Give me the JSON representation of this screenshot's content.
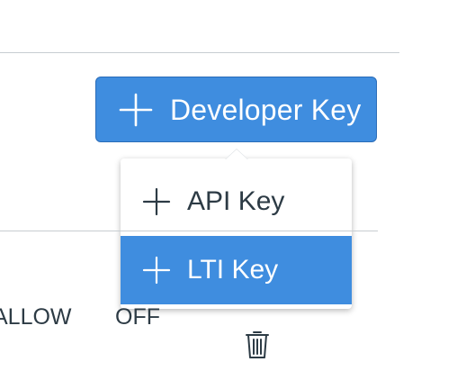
{
  "toolbar": {
    "developer_key_label": "Developer Key"
  },
  "menu": {
    "items": [
      {
        "label": "API Key",
        "selected": false
      },
      {
        "label": "LTI Key",
        "selected": true
      }
    ]
  },
  "table": {
    "row": {
      "status": "ALLOW",
      "state": "OFF"
    }
  },
  "colors": {
    "accent": "#3f8ddf",
    "text": "#2d3b45",
    "divider": "#c7cdd1"
  },
  "icons": {
    "button_plus": "plus-icon",
    "trash": "trash-icon"
  }
}
